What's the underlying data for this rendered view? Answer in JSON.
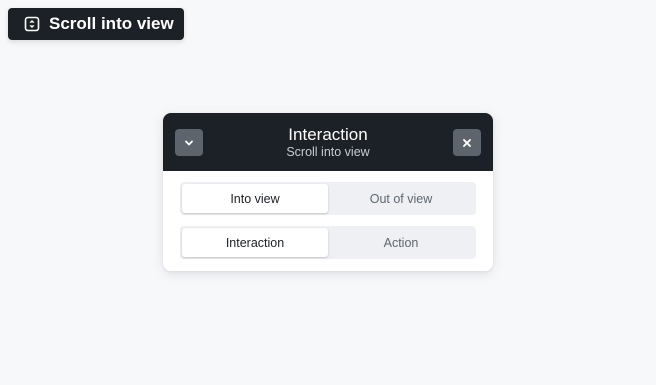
{
  "badge": {
    "label": "Scroll into view",
    "icon": "scroll-vertical-icon"
  },
  "panel": {
    "title": "Interaction",
    "subtitle": "Scroll into view",
    "collapse_icon": "chevron-down-icon",
    "close_icon": "close-icon",
    "colors": {
      "header_bg": "#1c2127",
      "button_bg": "#5d646c",
      "segment_track": "#eef0f3"
    },
    "toggles": [
      {
        "options": [
          "Into view",
          "Out of view"
        ],
        "selected": "Into view"
      },
      {
        "options": [
          "Interaction",
          "Action"
        ],
        "selected": "Interaction"
      }
    ]
  }
}
